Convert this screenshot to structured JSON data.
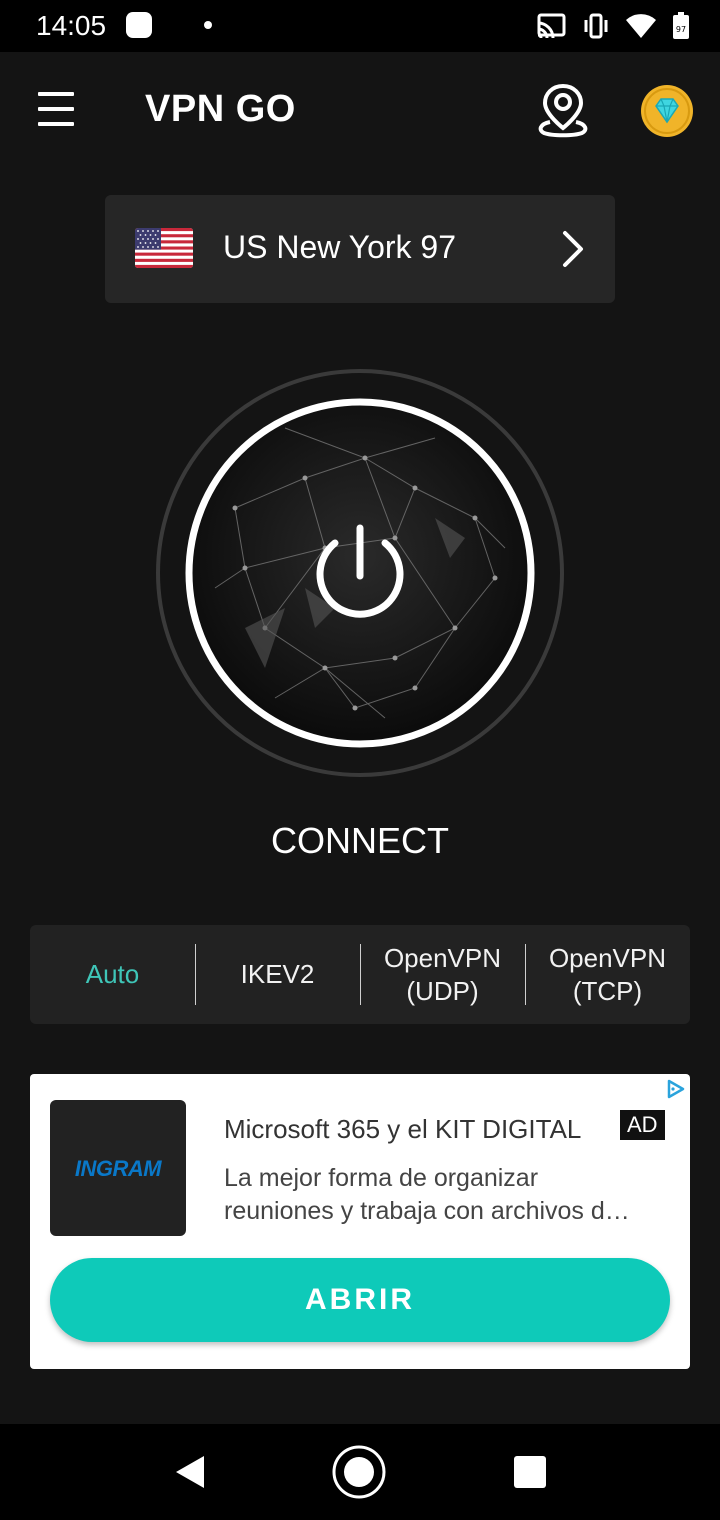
{
  "status_bar": {
    "time": "14:05",
    "icons": [
      "app-notification-icon",
      "dot-icon",
      "cast-icon",
      "vibrate-icon",
      "wifi-icon",
      "battery-icon"
    ],
    "battery_level": "97"
  },
  "app_bar": {
    "title": "VPN GO",
    "icons": [
      "menu-icon",
      "location-pin-icon",
      "premium-diamond-icon"
    ]
  },
  "server": {
    "country": "US",
    "flag": "us-flag-icon",
    "name": "US New York 97"
  },
  "connect": {
    "label": "CONNECT",
    "state": "disconnected"
  },
  "protocols": [
    {
      "label": "Auto",
      "selected": true
    },
    {
      "label": "IKEV2",
      "selected": false
    },
    {
      "label": "OpenVPN (UDP)",
      "selected": false
    },
    {
      "label": "OpenVPN (TCP)",
      "selected": false
    }
  ],
  "ad": {
    "logo_text": "INGRAM",
    "title": "Microsoft 365 y el KIT DIGITAL",
    "tag": "AD",
    "description_line1": "La mejor forma de organizar",
    "description_line2": "reuniones y trabaja con archivos d…",
    "cta": "ABRIR"
  },
  "colors": {
    "background": "#141414",
    "accent": "#3fc6b8",
    "cta": "#0ecab9",
    "card": "#262626",
    "premium": "#f0b429"
  }
}
